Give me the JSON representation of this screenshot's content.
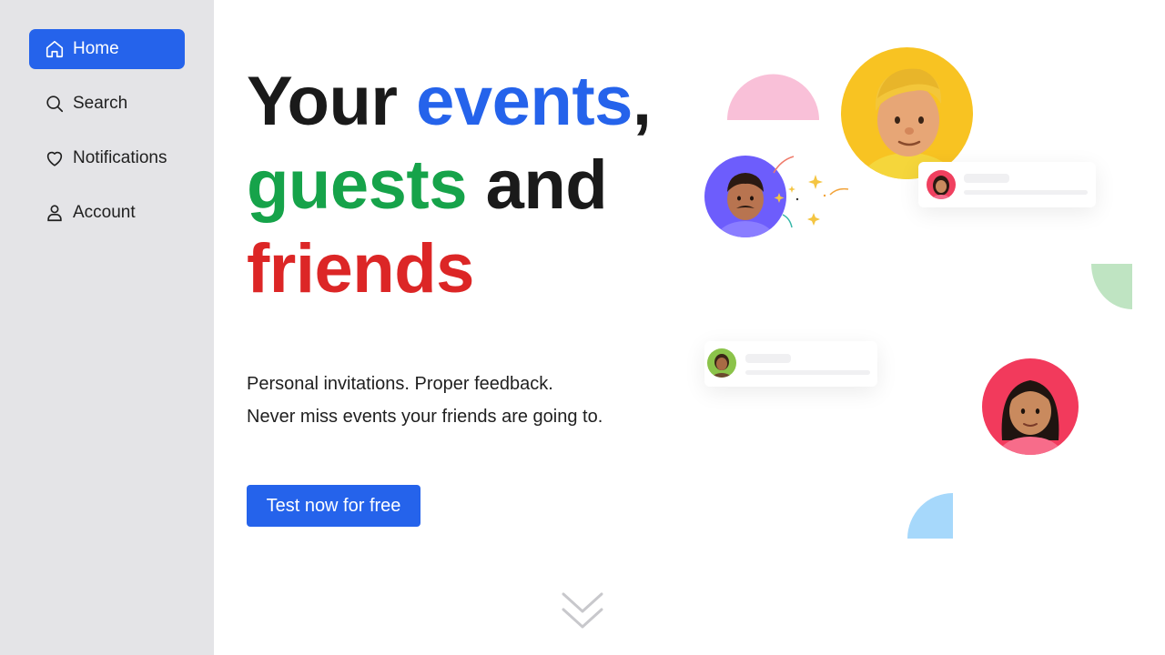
{
  "sidebar": {
    "items": [
      {
        "label": "Home",
        "icon": "home-icon",
        "active": true
      },
      {
        "label": "Search",
        "icon": "search-icon",
        "active": false
      },
      {
        "label": "Notifications",
        "icon": "heart-icon",
        "active": false
      },
      {
        "label": "Account",
        "icon": "user-icon",
        "active": false
      }
    ]
  },
  "hero": {
    "headline": {
      "w1": "Your",
      "w2": "events",
      "w3": ",",
      "w4": "guests",
      "w5": "and",
      "w6": "friends"
    },
    "sub_line1": "Personal invitations. Proper feedback.",
    "sub_line2": "Never miss events your friends are going to.",
    "cta_label": "Test now for free"
  },
  "colors": {
    "accent": "#2563eb",
    "green": "#16a34a",
    "red": "#dc2626",
    "sidebar_bg": "#e4e4e7"
  }
}
